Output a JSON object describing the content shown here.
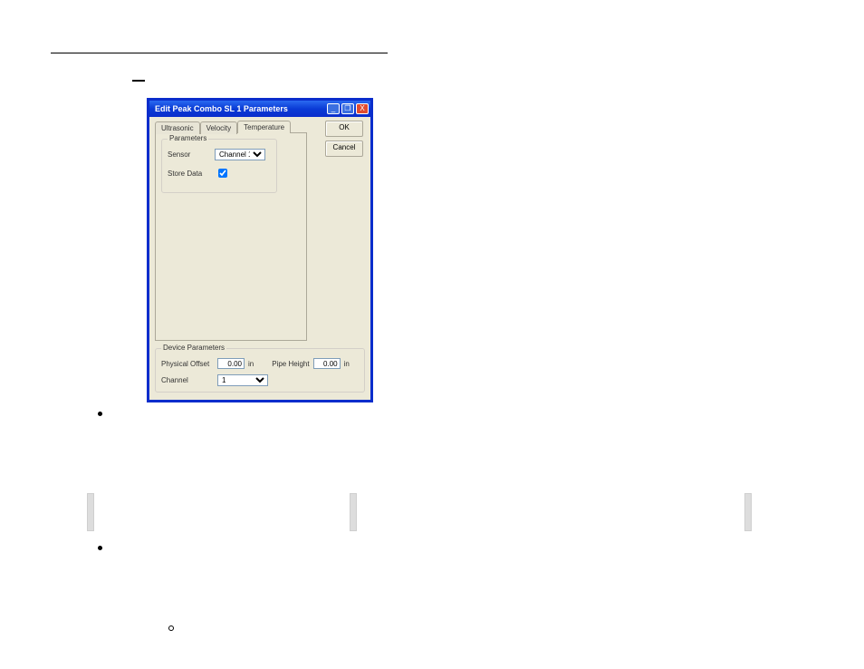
{
  "dialog": {
    "title": "Edit Peak Combo SL 1 Parameters",
    "buttons": {
      "ok": "OK",
      "cancel": "Cancel"
    },
    "titlebar": {
      "min": "_",
      "max": "❐",
      "close": "X"
    },
    "tabs": {
      "ultrasonic": "Ultrasonic",
      "velocity": "Velocity",
      "temperature": "Temperature"
    },
    "parameters": {
      "legend": "Parameters",
      "sensor_label": "Sensor",
      "sensor_value": "Channel 1",
      "store_label": "Store Data",
      "store_checked": true
    },
    "device": {
      "legend": "Device Parameters",
      "physical_offset_label": "Physical Offset",
      "physical_offset_value": "0.00",
      "physical_offset_unit": "in",
      "pipe_height_label": "Pipe Height",
      "pipe_height_value": "0.00",
      "pipe_height_unit": "in",
      "channel_label": "Channel",
      "channel_value": "1"
    }
  }
}
